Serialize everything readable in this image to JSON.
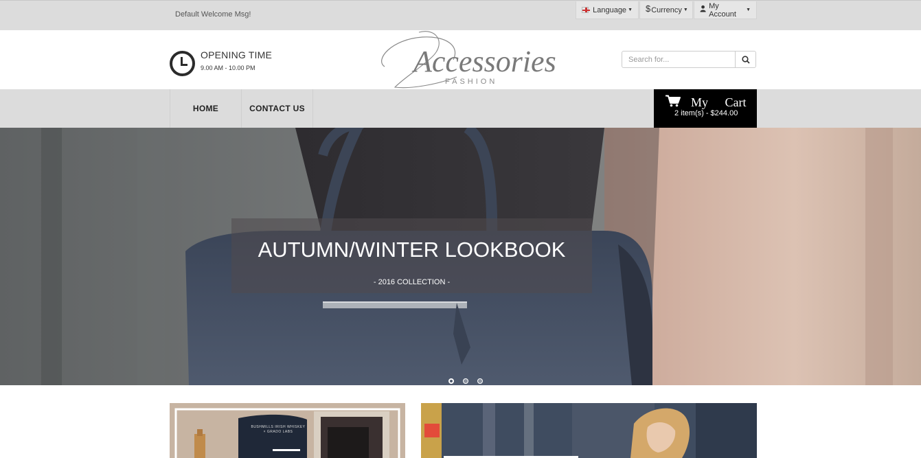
{
  "topbar": {
    "welcome": "Default Welcome Msg!",
    "language_label": "Language",
    "currency_symbol": "$",
    "currency_label": "Currency",
    "account_label": "My Account"
  },
  "header": {
    "opening_title": "OPENING TIME",
    "opening_hours": "9.00 AM - 10.00 PM",
    "logo_main": "Accessories",
    "logo_sub": "FASHION",
    "search_placeholder": "Search for..."
  },
  "nav": {
    "items": [
      {
        "label": "HOME"
      },
      {
        "label": "CONTACT US"
      }
    ]
  },
  "cart": {
    "title": "My Cart",
    "summary": "2 item(s) - $244.00"
  },
  "hero": {
    "title": "AUTUMN/WINTER LOOKBOOK",
    "subtitle": "- 2016 COLLECTION -",
    "slides": 3,
    "active_slide": 1
  },
  "banners": {
    "left_pouch_text": "BUSHMILLS IRISH WHISKEY × GRADO LABS"
  },
  "colors": {
    "topbar_bg": "#dcdcdc",
    "nav_bg": "#dcdcdc",
    "cart_bg": "#000000",
    "caption_bg": "rgba(80,75,78,0.55)"
  }
}
